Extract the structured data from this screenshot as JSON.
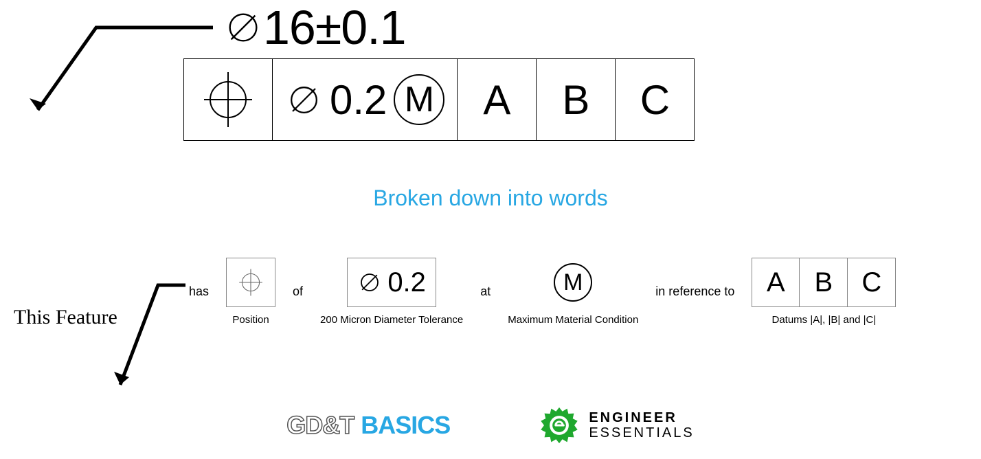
{
  "dimension": {
    "text": "16±0.1"
  },
  "fcf": {
    "tol_value": "0.2",
    "mmc_letter": "M",
    "datum_a": "A",
    "datum_b": "B",
    "datum_c": "C"
  },
  "subtitle": "Broken down into words",
  "breakdown": {
    "this_feature": "This Feature",
    "has": "has",
    "of": "of",
    "at": "at",
    "in_ref": "in reference to",
    "position_caption": "Position",
    "tolerance_value": "0.2",
    "tolerance_caption": "200 Micron Diameter Tolerance",
    "mmc_letter": "M",
    "mmc_caption": "Maximum Material Condition",
    "datum_a": "A",
    "datum_b": "B",
    "datum_c": "C",
    "datums_caption": "Datums |A|, |B| and |C|"
  },
  "logos": {
    "gdtb_1": "GD&T",
    "gdtb_2": "BASICS",
    "ee_1": "ENGINEER",
    "ee_2": "ESSENTIALS"
  }
}
